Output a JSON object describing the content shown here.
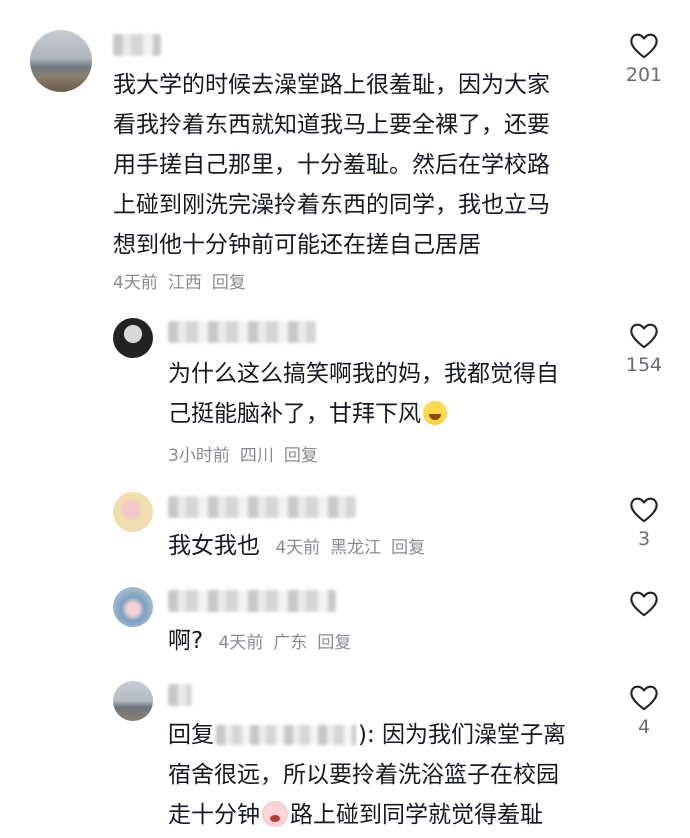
{
  "comments": [
    {
      "text_lines": [
        "我大学的时候去澡堂路上很羞耻，因为大家",
        "看我拎着东西就知道我马上要全裸了，还要",
        "用手搓自己那里，十分羞耻。然后在学校路",
        "上碰到刚洗完澡拎着东西的同学，我也立马",
        "想到他十分钟前可能还在搓自己居居"
      ],
      "time": "4天前",
      "location": "江西",
      "reply_label": "回复",
      "likes": "201"
    },
    {
      "text_lines": [
        "为什么这么搞笑啊我的妈，我都觉得自",
        "己挺能脑补了，甘拜下风"
      ],
      "time": "3小时前",
      "location": "四川",
      "reply_label": "回复",
      "likes": "154"
    },
    {
      "text": "我女我也",
      "time": "4天前",
      "location": "黑龙江",
      "reply_label": "回复",
      "likes": "3"
    },
    {
      "text": "啊?",
      "time": "4天前",
      "location": "广东",
      "reply_label": "回复",
      "likes": ""
    },
    {
      "reply_prefix": "回复",
      "line1_rest": "): 因为我们澡堂子离",
      "line2": "宿舍很远，所以要拎着洗浴篮子在校园",
      "line3_a": "走十分钟",
      "line3_b": "路上碰到同学就觉得羞耻",
      "likes": "4"
    }
  ],
  "icons": {
    "like": "heart-outline-icon",
    "laugh_emoji": "laughing-emoji-icon",
    "cry_emoji": "crying-emoji-icon"
  },
  "colors": {
    "text": "#161823",
    "meta": "#8a8b91",
    "heart_stroke": "#222222"
  }
}
